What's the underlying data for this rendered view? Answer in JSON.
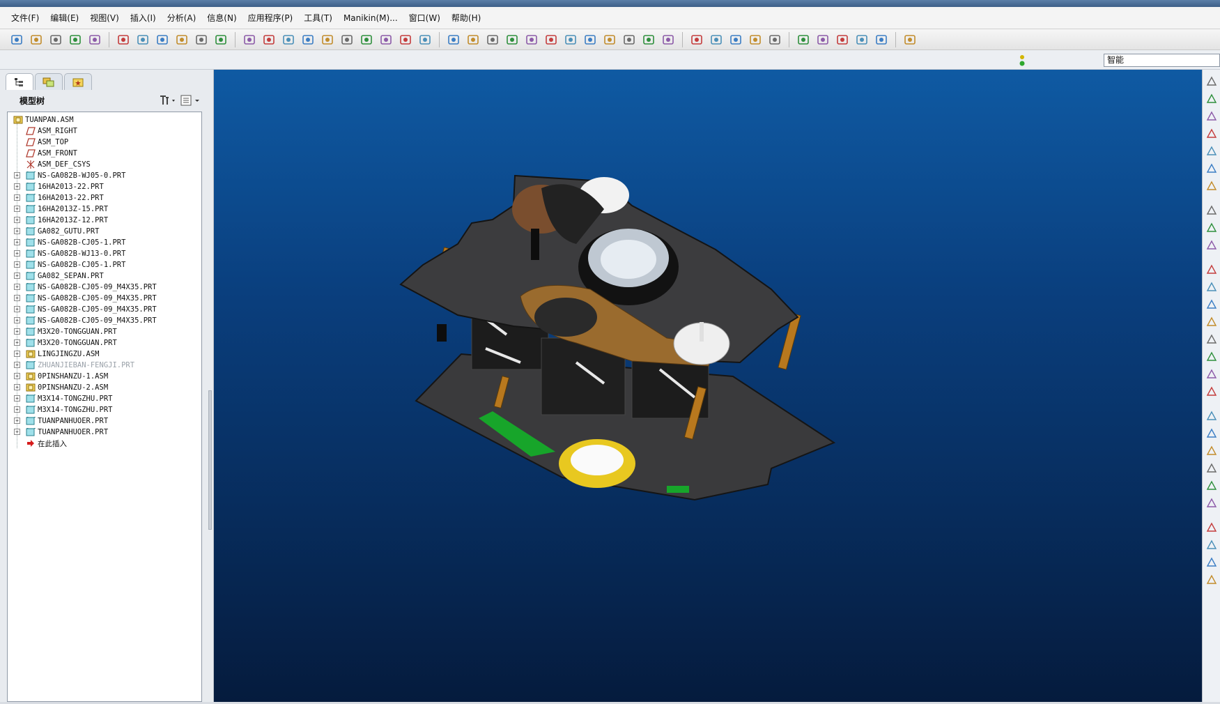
{
  "menu": [
    "文件(F)",
    "编辑(E)",
    "视图(V)",
    "插入(I)",
    "分析(A)",
    "信息(N)",
    "应用程序(P)",
    "工具(T)",
    "Manikin(M)...",
    "窗口(W)",
    "帮助(H)"
  ],
  "toolbar_icons": [
    "data-panel-icon",
    "shape-icon",
    "render-icon",
    "publish-icon",
    "connect-icon",
    "sep",
    "new-file-icon",
    "open-file-icon",
    "save-icon",
    "print-icon",
    "email-icon",
    "print-preview-icon",
    "sep",
    "undo-icon",
    "redo-icon",
    "cut-icon",
    "copy-icon",
    "paste-icon",
    "paste-special-icon",
    "regenerate-icon",
    "regen-manager-icon",
    "find-icon",
    "select-box-icon",
    "sep",
    "sketch-icon",
    "datum-display-icon",
    "component-display-icon",
    "shading-icon",
    "pan-icon",
    "zoom-in-icon",
    "zoom-out-icon",
    "refit-icon",
    "orient-icon",
    "saved-views-icon",
    "layers-icon",
    "view-manager-icon",
    "sep",
    "wireframe-icon",
    "hidden-line-icon",
    "no-hidden-icon",
    "shaded-icon",
    "enhanced-realism-icon",
    "sep",
    "datum-planes-icon",
    "datum-axes-icon",
    "datum-points-icon",
    "coord-sys-icon",
    "annotation-icon",
    "sep",
    "context-help-icon"
  ],
  "smart_filter": "智能",
  "tabs": [
    "model-tree-tab",
    "layer-tree-tab",
    "favorites-tab"
  ],
  "model_tree": {
    "title": "模型树",
    "items": [
      {
        "label": "TUANPAN.ASM",
        "icon": "assembly-icon",
        "level": 0,
        "expand": false,
        "dim": false
      },
      {
        "label": "ASM_RIGHT",
        "icon": "datum-plane-icon",
        "level": 1,
        "expand": false,
        "dim": false
      },
      {
        "label": "ASM_TOP",
        "icon": "datum-plane-icon",
        "level": 1,
        "expand": false,
        "dim": false
      },
      {
        "label": "ASM_FRONT",
        "icon": "datum-plane-icon",
        "level": 1,
        "expand": false,
        "dim": false
      },
      {
        "label": "ASM_DEF_CSYS",
        "icon": "csys-icon",
        "level": 1,
        "expand": false,
        "dim": false
      },
      {
        "label": "NS-GA082B-WJ05-0.PRT",
        "icon": "part-icon",
        "level": 1,
        "expand": true,
        "dim": false
      },
      {
        "label": "16HA2013-22.PRT",
        "icon": "part-icon",
        "level": 1,
        "expand": true,
        "dim": false
      },
      {
        "label": "16HA2013-22.PRT",
        "icon": "part-icon",
        "level": 1,
        "expand": true,
        "dim": false
      },
      {
        "label": "16HA2013Z-15.PRT",
        "icon": "part-icon",
        "level": 1,
        "expand": true,
        "dim": false
      },
      {
        "label": "16HA2013Z-12.PRT",
        "icon": "part-icon",
        "level": 1,
        "expand": true,
        "dim": false
      },
      {
        "label": "GA082_GUTU.PRT",
        "icon": "part-icon",
        "level": 1,
        "expand": true,
        "dim": false
      },
      {
        "label": "NS-GA082B-CJ05-1.PRT",
        "icon": "part-icon",
        "level": 1,
        "expand": true,
        "dim": false
      },
      {
        "label": "NS-GA082B-WJ13-0.PRT",
        "icon": "part-icon",
        "level": 1,
        "expand": true,
        "dim": false
      },
      {
        "label": "NS-GA082B-CJ05-1.PRT",
        "icon": "part-icon",
        "level": 1,
        "expand": true,
        "dim": false
      },
      {
        "label": "GA082_SEPAN.PRT",
        "icon": "part-icon",
        "level": 1,
        "expand": true,
        "dim": false
      },
      {
        "label": "NS-GA082B-CJ05-09_M4X35.PRT",
        "icon": "part-icon",
        "level": 1,
        "expand": true,
        "dim": false
      },
      {
        "label": "NS-GA082B-CJ05-09_M4X35.PRT",
        "icon": "part-icon",
        "level": 1,
        "expand": true,
        "dim": false
      },
      {
        "label": "NS-GA082B-CJ05-09_M4X35.PRT",
        "icon": "part-icon",
        "level": 1,
        "expand": true,
        "dim": false
      },
      {
        "label": "NS-GA082B-CJ05-09_M4X35.PRT",
        "icon": "part-icon",
        "level": 1,
        "expand": true,
        "dim": false
      },
      {
        "label": "M3X20-TONGGUAN.PRT",
        "icon": "part-icon",
        "level": 1,
        "expand": true,
        "dim": false
      },
      {
        "label": "M3X20-TONGGUAN.PRT",
        "icon": "part-icon",
        "level": 1,
        "expand": true,
        "dim": false
      },
      {
        "label": "LINGJINGZU.ASM",
        "icon": "assembly-icon",
        "level": 1,
        "expand": true,
        "dim": false
      },
      {
        "label": "ZHUANJIEBAN-FENGJI.PRT",
        "icon": "part-icon",
        "level": 1,
        "expand": true,
        "dim": true
      },
      {
        "label": "0PINSHANZU-1.ASM",
        "icon": "assembly-icon",
        "level": 1,
        "expand": true,
        "dim": false
      },
      {
        "label": "0PINSHANZU-2.ASM",
        "icon": "assembly-icon",
        "level": 1,
        "expand": true,
        "dim": false
      },
      {
        "label": "M3X14-TONGZHU.PRT",
        "icon": "part-icon",
        "level": 1,
        "expand": true,
        "dim": false
      },
      {
        "label": "M3X14-TONGZHU.PRT",
        "icon": "part-icon",
        "level": 1,
        "expand": true,
        "dim": false
      },
      {
        "label": "TUANPANHUOER.PRT",
        "icon": "part-icon",
        "level": 1,
        "expand": true,
        "dim": false
      },
      {
        "label": "TUANPANHUOER.PRT",
        "icon": "part-icon",
        "level": 1,
        "expand": true,
        "dim": false
      },
      {
        "label": "在此插入",
        "icon": "insert-arrow-icon",
        "level": 1,
        "expand": false,
        "dim": false
      }
    ]
  },
  "right_toolbar": [
    "sketch-datum-icon",
    "plane-icon",
    "axis-icon",
    "curve-icon",
    "point-icon",
    "csys-tool-icon",
    "analysis-icon",
    "sep",
    "component-icon",
    "assemble-icon",
    "package-icon",
    "sep",
    "extrude-icon",
    "revolve-icon",
    "sweep-icon",
    "blend-icon",
    "hole-icon",
    "shell-icon",
    "rib-icon",
    "draft-icon",
    "sep",
    "round-icon",
    "chamfer-icon",
    "pattern-icon",
    "mirror-icon",
    "merge-icon",
    "trim-icon",
    "sep",
    "offset-icon",
    "thicken-icon",
    "solidify-icon",
    "repeat-icon"
  ],
  "colors": {
    "viewport_top": "#0f5aa3",
    "viewport_bottom": "#051b3d",
    "accent": "#2c6fb3"
  }
}
